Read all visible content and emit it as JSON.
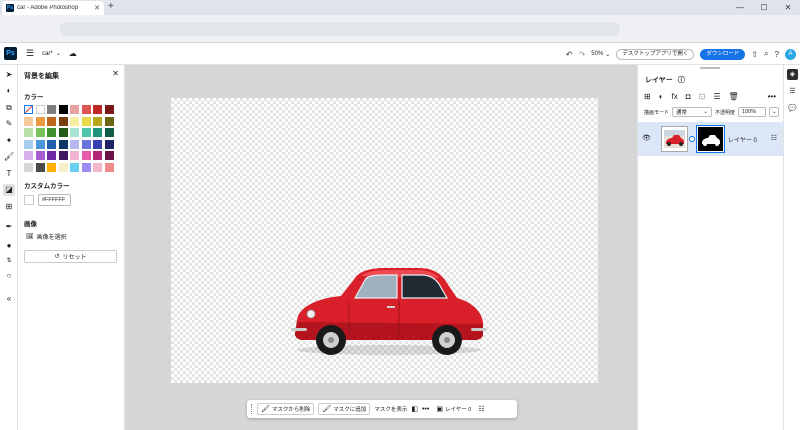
{
  "browser": {
    "tab_title": "car - Adobe Photoshop",
    "tab_icon_text": "Ps",
    "new_tab": "+",
    "window_controls": [
      "—",
      "☐",
      "✕"
    ]
  },
  "header": {
    "logo_text": "Ps",
    "doc_name": "car*",
    "zoom": "50%",
    "open_desktop_label": "デスクトップアプリで開く",
    "download_label": "ダウンロード",
    "avatar_text": "A"
  },
  "left_panel": {
    "title": "背景を編集",
    "color_heading": "カラー",
    "custom_color_heading": "カスタムカラー",
    "hex_value": "#FFFFFF",
    "image_heading": "画像",
    "select_image_label": "画像を選択",
    "reset_label": "リセット",
    "swatches": [
      [
        "transparent",
        "#ffffff",
        "#7f7f7f",
        "#000000",
        "#e8a1a1",
        "#e05353",
        "#c02626",
        "#7a1717"
      ],
      [
        "#f6c99b",
        "#ec9a3f",
        "#c0661a",
        "#7a3d0f",
        "#f7efa0",
        "#e8d94a",
        "#b5a81f",
        "#6b6411"
      ],
      [
        "#b9e0a6",
        "#7ac25a",
        "#3f8f2c",
        "#235a18",
        "#a8e3d4",
        "#4fc6aa",
        "#1e9478",
        "#0f5a48"
      ],
      [
        "#a9cdef",
        "#4b97dc",
        "#1f5fae",
        "#0f3567",
        "#b5b9ef",
        "#6d73dc",
        "#3a3fb0",
        "#1f2268"
      ],
      [
        "#d8b0ea",
        "#a65dd2",
        "#6e2aa2",
        "#3f1565",
        "#f1b3d6",
        "#e45ca9",
        "#b42778",
        "#6a1446"
      ],
      [
        "#d6d6d6",
        "#4a4a4a",
        "#ffb000",
        "#f5f0c8",
        "#6ad0f0",
        "#9b8ef2",
        "#f4b6cf",
        "#f08a8a"
      ]
    ]
  },
  "taskbar": {
    "remove_mask": "マスクから削除",
    "add_mask": "マスクに追加",
    "show_mask": "マスクを表示",
    "layer_label": "レイヤー 0"
  },
  "layers_panel": {
    "title": "レイヤー",
    "blend_label": "描画モード",
    "blend_value": "通常",
    "opacity_label": "不透明度",
    "opacity_value": "100%",
    "layer_name": "レイヤー 0"
  },
  "colors": {
    "accent": "#1473e6",
    "car_red": "#d9202a"
  }
}
